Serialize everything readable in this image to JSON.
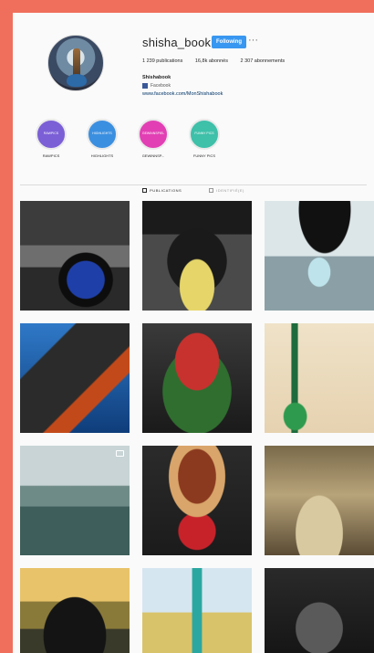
{
  "profile": {
    "username": "shisha_book",
    "follow_label": "Following",
    "more_label": "···",
    "stats": {
      "posts": "1 239 publications",
      "followers": "16,8k abonnés",
      "following": "2 307 abonnements"
    },
    "bio": {
      "name": "Shishabook",
      "facebook": "Facebook",
      "link": "www.facebook.com/MonShishabook"
    }
  },
  "highlights": [
    {
      "label": "RAWPICS",
      "inner": "RAWPICS",
      "color": "#7b5fd6"
    },
    {
      "label": "HIGHLIGHTS",
      "inner": "HIGHLIGHTS",
      "color": "#3b8fe0"
    },
    {
      "label": "GEWINNSP...",
      "inner": "GEWINNSPIEL",
      "color": "#e23fb4"
    },
    {
      "label": "FUNNY PICS",
      "inner": "FUNNY PICS",
      "color": "#3ec0a9"
    }
  ],
  "tabs": [
    {
      "label": "PUBLICATIONS",
      "active": true
    },
    {
      "label": "IDENTIFIÉ(E)",
      "active": false
    }
  ],
  "grid": {
    "tiles": [
      {
        "subject": "hookah-lounge"
      },
      {
        "subject": "hookah-wheel"
      },
      {
        "subject": "woman-umbrella"
      },
      {
        "subject": "burning-coal"
      },
      {
        "subject": "watermelon-bowl"
      },
      {
        "subject": "hookah-illustration"
      },
      {
        "subject": "sea-video"
      },
      {
        "subject": "tobacco-bowl"
      },
      {
        "subject": "crowd-smoking"
      },
      {
        "subject": "black-car"
      },
      {
        "subject": "hookah-field"
      },
      {
        "subject": "car-interior"
      }
    ]
  }
}
